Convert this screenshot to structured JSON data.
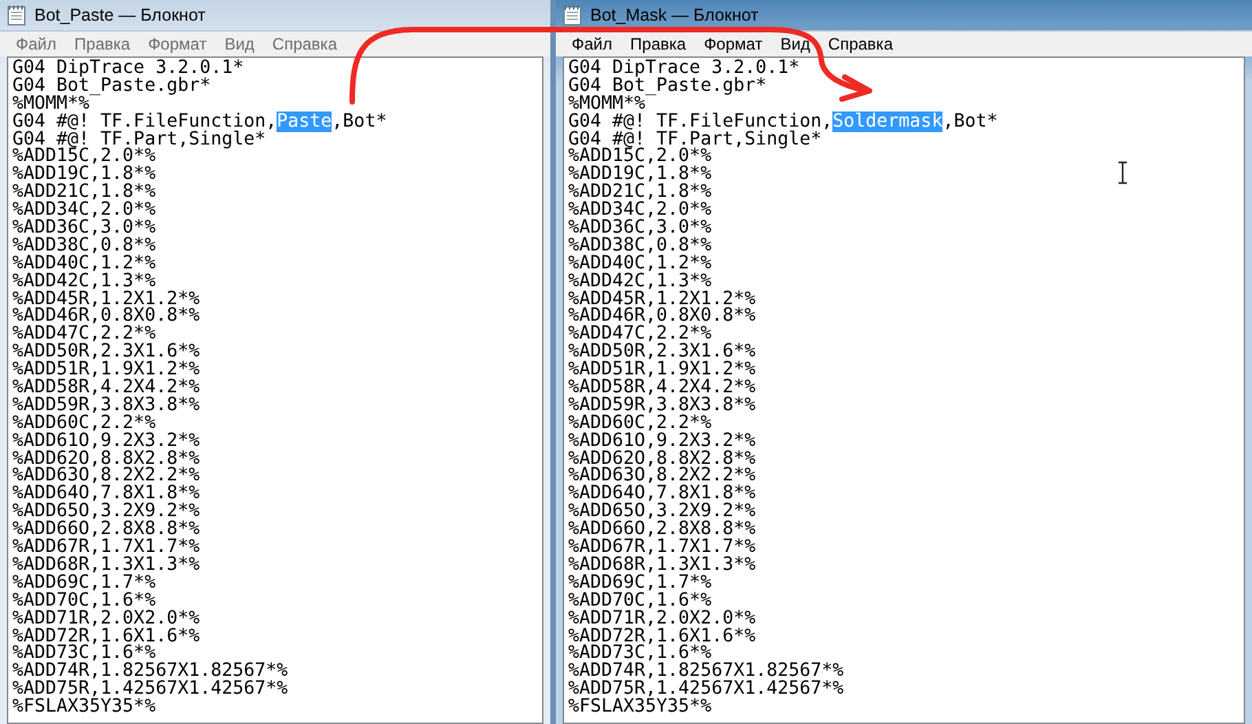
{
  "windows": [
    {
      "title": "Bot_Paste — Блокнот",
      "active": false,
      "menu": [
        "Файл",
        "Правка",
        "Формат",
        "Вид",
        "Справка"
      ],
      "lines": [
        [
          {
            "text": "G04 DipTrace 3.2.0.1*",
            "selected": false
          }
        ],
        [
          {
            "text": "G04 Bot_Paste.gbr*",
            "selected": false
          }
        ],
        [
          {
            "text": "%MOMM*%",
            "selected": false
          }
        ],
        [
          {
            "text": "G04 #@! TF.FileFunction,",
            "selected": false
          },
          {
            "text": "Paste",
            "selected": true
          },
          {
            "text": ",Bot*",
            "selected": false
          }
        ],
        [
          {
            "text": "G04 #@! TF.Part,Single*",
            "selected": false
          }
        ],
        [
          {
            "text": "%ADD15C,2.0*%",
            "selected": false
          }
        ],
        [
          {
            "text": "%ADD19C,1.8*%",
            "selected": false
          }
        ],
        [
          {
            "text": "%ADD21C,1.8*%",
            "selected": false
          }
        ],
        [
          {
            "text": "%ADD34C,2.0*%",
            "selected": false
          }
        ],
        [
          {
            "text": "%ADD36C,3.0*%",
            "selected": false
          }
        ],
        [
          {
            "text": "%ADD38C,0.8*%",
            "selected": false
          }
        ],
        [
          {
            "text": "%ADD40C,1.2*%",
            "selected": false
          }
        ],
        [
          {
            "text": "%ADD42C,1.3*%",
            "selected": false
          }
        ],
        [
          {
            "text": "%ADD45R,1.2X1.2*%",
            "selected": false
          }
        ],
        [
          {
            "text": "%ADD46R,0.8X0.8*%",
            "selected": false
          }
        ],
        [
          {
            "text": "%ADD47C,2.2*%",
            "selected": false
          }
        ],
        [
          {
            "text": "%ADD50R,2.3X1.6*%",
            "selected": false
          }
        ],
        [
          {
            "text": "%ADD51R,1.9X1.2*%",
            "selected": false
          }
        ],
        [
          {
            "text": "%ADD58R,4.2X4.2*%",
            "selected": false
          }
        ],
        [
          {
            "text": "%ADD59R,3.8X3.8*%",
            "selected": false
          }
        ],
        [
          {
            "text": "%ADD60C,2.2*%",
            "selected": false
          }
        ],
        [
          {
            "text": "%ADD61O,9.2X3.2*%",
            "selected": false
          }
        ],
        [
          {
            "text": "%ADD62O,8.8X2.8*%",
            "selected": false
          }
        ],
        [
          {
            "text": "%ADD63O,8.2X2.2*%",
            "selected": false
          }
        ],
        [
          {
            "text": "%ADD64O,7.8X1.8*%",
            "selected": false
          }
        ],
        [
          {
            "text": "%ADD65O,3.2X9.2*%",
            "selected": false
          }
        ],
        [
          {
            "text": "%ADD66O,2.8X8.8*%",
            "selected": false
          }
        ],
        [
          {
            "text": "%ADD67R,1.7X1.7*%",
            "selected": false
          }
        ],
        [
          {
            "text": "%ADD68R,1.3X1.3*%",
            "selected": false
          }
        ],
        [
          {
            "text": "%ADD69C,1.7*%",
            "selected": false
          }
        ],
        [
          {
            "text": "%ADD70C,1.6*%",
            "selected": false
          }
        ],
        [
          {
            "text": "%ADD71R,2.0X2.0*%",
            "selected": false
          }
        ],
        [
          {
            "text": "%ADD72R,1.6X1.6*%",
            "selected": false
          }
        ],
        [
          {
            "text": "%ADD73C,1.6*%",
            "selected": false
          }
        ],
        [
          {
            "text": "%ADD74R,1.82567X1.82567*%",
            "selected": false
          }
        ],
        [
          {
            "text": "%ADD75R,1.42567X1.42567*%",
            "selected": false
          }
        ],
        [
          {
            "text": "%FSLAX35Y35*%",
            "selected": false
          }
        ]
      ]
    },
    {
      "title": "Bot_Mask — Блокнот",
      "active": true,
      "menu": [
        "Файл",
        "Правка",
        "Формат",
        "Вид",
        "Справка"
      ],
      "lines": [
        [
          {
            "text": "G04 DipTrace 3.2.0.1*",
            "selected": false
          }
        ],
        [
          {
            "text": "G04 Bot_Paste.gbr*",
            "selected": false
          }
        ],
        [
          {
            "text": "%MOMM*%",
            "selected": false
          }
        ],
        [
          {
            "text": "G04 #@! TF.FileFunction,",
            "selected": false
          },
          {
            "text": "Soldermask",
            "selected": true
          },
          {
            "text": ",Bot*",
            "selected": false
          }
        ],
        [
          {
            "text": "G04 #@! TF.Part,Single*",
            "selected": false
          }
        ],
        [
          {
            "text": "%ADD15C,2.0*%",
            "selected": false
          }
        ],
        [
          {
            "text": "%ADD19C,1.8*%",
            "selected": false
          }
        ],
        [
          {
            "text": "%ADD21C,1.8*%",
            "selected": false
          }
        ],
        [
          {
            "text": "%ADD34C,2.0*%",
            "selected": false
          }
        ],
        [
          {
            "text": "%ADD36C,3.0*%",
            "selected": false
          }
        ],
        [
          {
            "text": "%ADD38C,0.8*%",
            "selected": false
          }
        ],
        [
          {
            "text": "%ADD40C,1.2*%",
            "selected": false
          }
        ],
        [
          {
            "text": "%ADD42C,1.3*%",
            "selected": false
          }
        ],
        [
          {
            "text": "%ADD45R,1.2X1.2*%",
            "selected": false
          }
        ],
        [
          {
            "text": "%ADD46R,0.8X0.8*%",
            "selected": false
          }
        ],
        [
          {
            "text": "%ADD47C,2.2*%",
            "selected": false
          }
        ],
        [
          {
            "text": "%ADD50R,2.3X1.6*%",
            "selected": false
          }
        ],
        [
          {
            "text": "%ADD51R,1.9X1.2*%",
            "selected": false
          }
        ],
        [
          {
            "text": "%ADD58R,4.2X4.2*%",
            "selected": false
          }
        ],
        [
          {
            "text": "%ADD59R,3.8X3.8*%",
            "selected": false
          }
        ],
        [
          {
            "text": "%ADD60C,2.2*%",
            "selected": false
          }
        ],
        [
          {
            "text": "%ADD61O,9.2X3.2*%",
            "selected": false
          }
        ],
        [
          {
            "text": "%ADD62O,8.8X2.8*%",
            "selected": false
          }
        ],
        [
          {
            "text": "%ADD63O,8.2X2.2*%",
            "selected": false
          }
        ],
        [
          {
            "text": "%ADD64O,7.8X1.8*%",
            "selected": false
          }
        ],
        [
          {
            "text": "%ADD65O,3.2X9.2*%",
            "selected": false
          }
        ],
        [
          {
            "text": "%ADD66O,2.8X8.8*%",
            "selected": false
          }
        ],
        [
          {
            "text": "%ADD67R,1.7X1.7*%",
            "selected": false
          }
        ],
        [
          {
            "text": "%ADD68R,1.3X1.3*%",
            "selected": false
          }
        ],
        [
          {
            "text": "%ADD69C,1.7*%",
            "selected": false
          }
        ],
        [
          {
            "text": "%ADD70C,1.6*%",
            "selected": false
          }
        ],
        [
          {
            "text": "%ADD71R,2.0X2.0*%",
            "selected": false
          }
        ],
        [
          {
            "text": "%ADD72R,1.6X1.6*%",
            "selected": false
          }
        ],
        [
          {
            "text": "%ADD73C,1.6*%",
            "selected": false
          }
        ],
        [
          {
            "text": "%ADD74R,1.82567X1.82567*%",
            "selected": false
          }
        ],
        [
          {
            "text": "%ADD75R,1.42567X1.42567*%",
            "selected": false
          }
        ],
        [
          {
            "text": "%FSLAX35Y35*%",
            "selected": false
          }
        ]
      ]
    }
  ]
}
